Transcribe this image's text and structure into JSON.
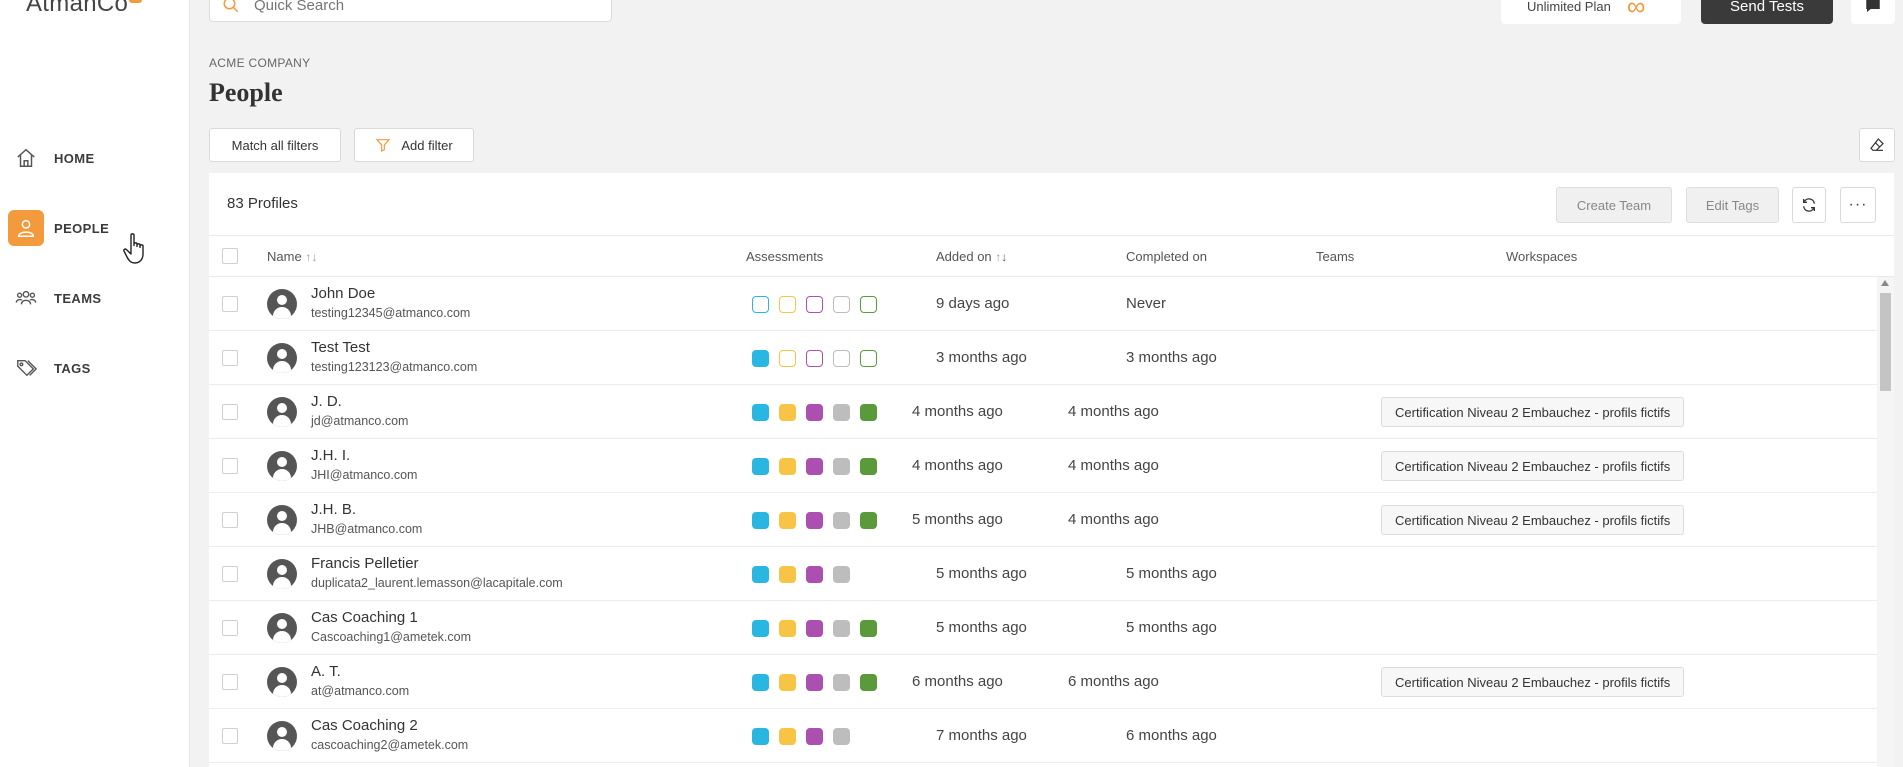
{
  "app": {
    "logo_text": "AtmanCo"
  },
  "sidebar": {
    "items": [
      {
        "label": "HOME",
        "icon": "home-icon"
      },
      {
        "label": "PEOPLE",
        "icon": "person-icon",
        "active": true
      },
      {
        "label": "TEAMS",
        "icon": "teams-icon"
      },
      {
        "label": "TAGS",
        "icon": "tags-icon"
      }
    ]
  },
  "topbar": {
    "search_placeholder": "Quick Search",
    "plan_label": "Unlimited Plan",
    "plan_symbol": "∞",
    "send_tests_label": "Send Tests"
  },
  "page": {
    "company": "ACME COMPANY",
    "title": "People"
  },
  "filters": {
    "match_label": "Match all filters",
    "add_filter_label": "Add filter"
  },
  "table": {
    "profiles_count": "83",
    "profiles_label": "Profiles",
    "create_team_label": "Create Team",
    "edit_tags_label": "Edit Tags",
    "more_label": "···",
    "columns": {
      "name": "Name",
      "name_sort": "↑↓",
      "assessments": "Assessments",
      "added_on": "Added on",
      "added_sort_up": "↑",
      "added_sort_down": "↓",
      "completed_on": "Completed on",
      "teams": "Teams",
      "workspaces": "Workspaces"
    },
    "assessment_colors": [
      "#29b6e0",
      "#f8c445",
      "#ab4fb1",
      "#bdbdbd",
      "#5a9a3a"
    ],
    "rows": [
      {
        "name": "John Doe",
        "email": "testing12345@atmanco.com",
        "assess": [
          "outline",
          "outline",
          "outline",
          "outline",
          "outline"
        ],
        "added": "9 days ago",
        "completed": "Never",
        "workspace": ""
      },
      {
        "name": "Test Test",
        "email": "testing123123@atmanco.com",
        "assess": [
          "fill",
          "outline",
          "outline",
          "outline",
          "outline"
        ],
        "added": "3 months ago",
        "completed": "3 months ago",
        "workspace": ""
      },
      {
        "name": "J. D.",
        "email": "jd@atmanco.com",
        "assess": [
          "fill",
          "fill",
          "fill",
          "fill",
          "fill"
        ],
        "added": "4 months ago",
        "completed": "4 months ago",
        "workspace": "Certification Niveau 2 Embauchez - profils fictifs"
      },
      {
        "name": "J.H. I.",
        "email": "JHI@atmanco.com",
        "assess": [
          "fill",
          "fill",
          "fill",
          "fill",
          "fill"
        ],
        "added": "4 months ago",
        "completed": "4 months ago",
        "workspace": "Certification Niveau 2 Embauchez - profils fictifs"
      },
      {
        "name": "J.H. B.",
        "email": "JHB@atmanco.com",
        "assess": [
          "fill",
          "fill",
          "fill",
          "fill",
          "fill"
        ],
        "added": "5 months ago",
        "completed": "4 months ago",
        "workspace": "Certification Niveau 2 Embauchez - profils fictifs"
      },
      {
        "name": "Francis Pelletier",
        "email": "duplicata2_laurent.lemasson@lacapitale.com",
        "assess": [
          "fill",
          "fill",
          "fill",
          "fill"
        ],
        "added": "5 months ago",
        "completed": "5 months ago",
        "workspace": ""
      },
      {
        "name": "Cas Coaching 1",
        "email": "Cascoaching1@ametek.com",
        "assess": [
          "fill",
          "fill",
          "fill",
          "fill",
          "fill"
        ],
        "added": "5 months ago",
        "completed": "5 months ago",
        "workspace": ""
      },
      {
        "name": "A. T.",
        "email": "at@atmanco.com",
        "assess": [
          "fill",
          "fill",
          "fill",
          "fill",
          "fill"
        ],
        "added": "6 months ago",
        "completed": "6 months ago",
        "workspace": "Certification Niveau 2 Embauchez - profils fictifs"
      },
      {
        "name": "Cas Coaching 2",
        "email": "cascoaching2@ametek.com",
        "assess": [
          "fill",
          "fill",
          "fill",
          "fill"
        ],
        "added": "7 months ago",
        "completed": "6 months ago",
        "workspace": ""
      }
    ]
  }
}
